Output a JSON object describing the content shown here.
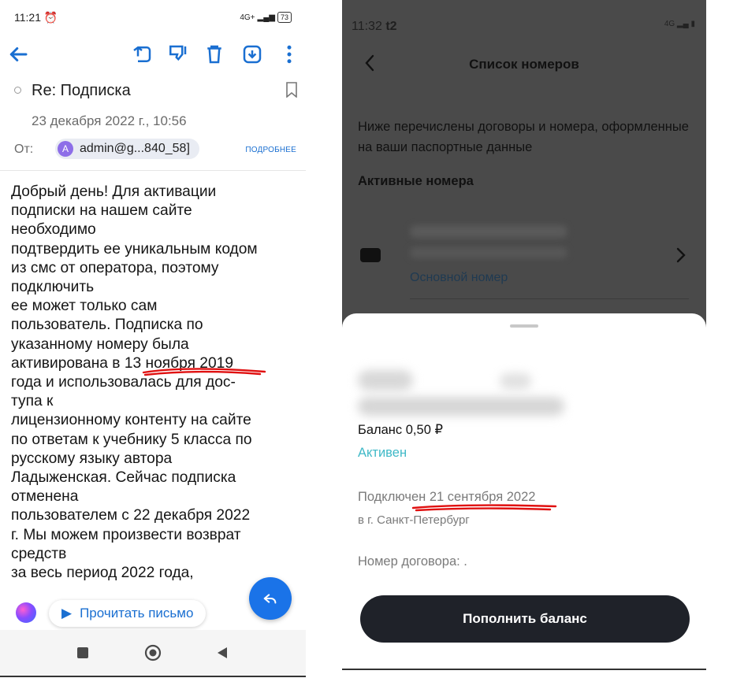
{
  "email_screen": {
    "status": {
      "time": "11:21",
      "network": "4G+",
      "battery": "73"
    },
    "subject": "Re: Подписка",
    "date": "23 декабря 2022 г., 10:56",
    "from_label": "От:",
    "sender_avatar_letter": "A",
    "sender_address": "admin@g...840_58]",
    "details_link": "ПОДРОБНЕЕ",
    "body_lines": [
      "Добрый день! Для активации",
      "подписки на нашем сайте",
      "необходимо",
      "подтвердить ее уникальным кодом",
      "из смс от оператора, поэтому",
      "подключить",
      "ее может только сам",
      "пользователь. Подписка по",
      "указанному номеру была",
      "активирована в 13 ноября 2019",
      "года и использовалась для дос-",
      "тупа к",
      "лицензионному контенту на сайте",
      "по ответам к учебнику 5 класса по",
      "русскому языку автора",
      "Ладыженская. Сейчас подписка",
      "отменена",
      "пользователем с 22 декабря 2022",
      "г. Мы можем произвести возврат",
      "средств",
      "за весь период 2022 года,"
    ],
    "read_aloud_button": "Прочитать письмо",
    "icons": {
      "back": "back-arrow-icon",
      "move": "move-icon",
      "report": "report-icon",
      "delete": "delete-icon",
      "download": "download-icon",
      "more": "more-vert-icon",
      "bookmark": "bookmark-icon",
      "reply": "reply-icon"
    },
    "accent_color": "#1a6fd1",
    "highlight_color": "#e01010"
  },
  "numbers_screen": {
    "status": {
      "time": "11:32",
      "carrier": "t2",
      "network": "4G"
    },
    "title": "Список номеров",
    "description": "Ниже перечислены договоры и номера, оформленные на ваши паспортные данные",
    "active_heading": "Активные номера",
    "primary_label": "Основной номер",
    "balance": "Баланс 0,50 ₽",
    "status_text": "Активен",
    "connected_label": "Подключен",
    "connected_date": "21 сентября 2022",
    "city": "в г. Санкт-Петербург",
    "contract_label": "Номер договора: .",
    "topup_button": "Пополнить баланс",
    "status_color": "#3fb9c7",
    "button_color": "#1f2229"
  }
}
